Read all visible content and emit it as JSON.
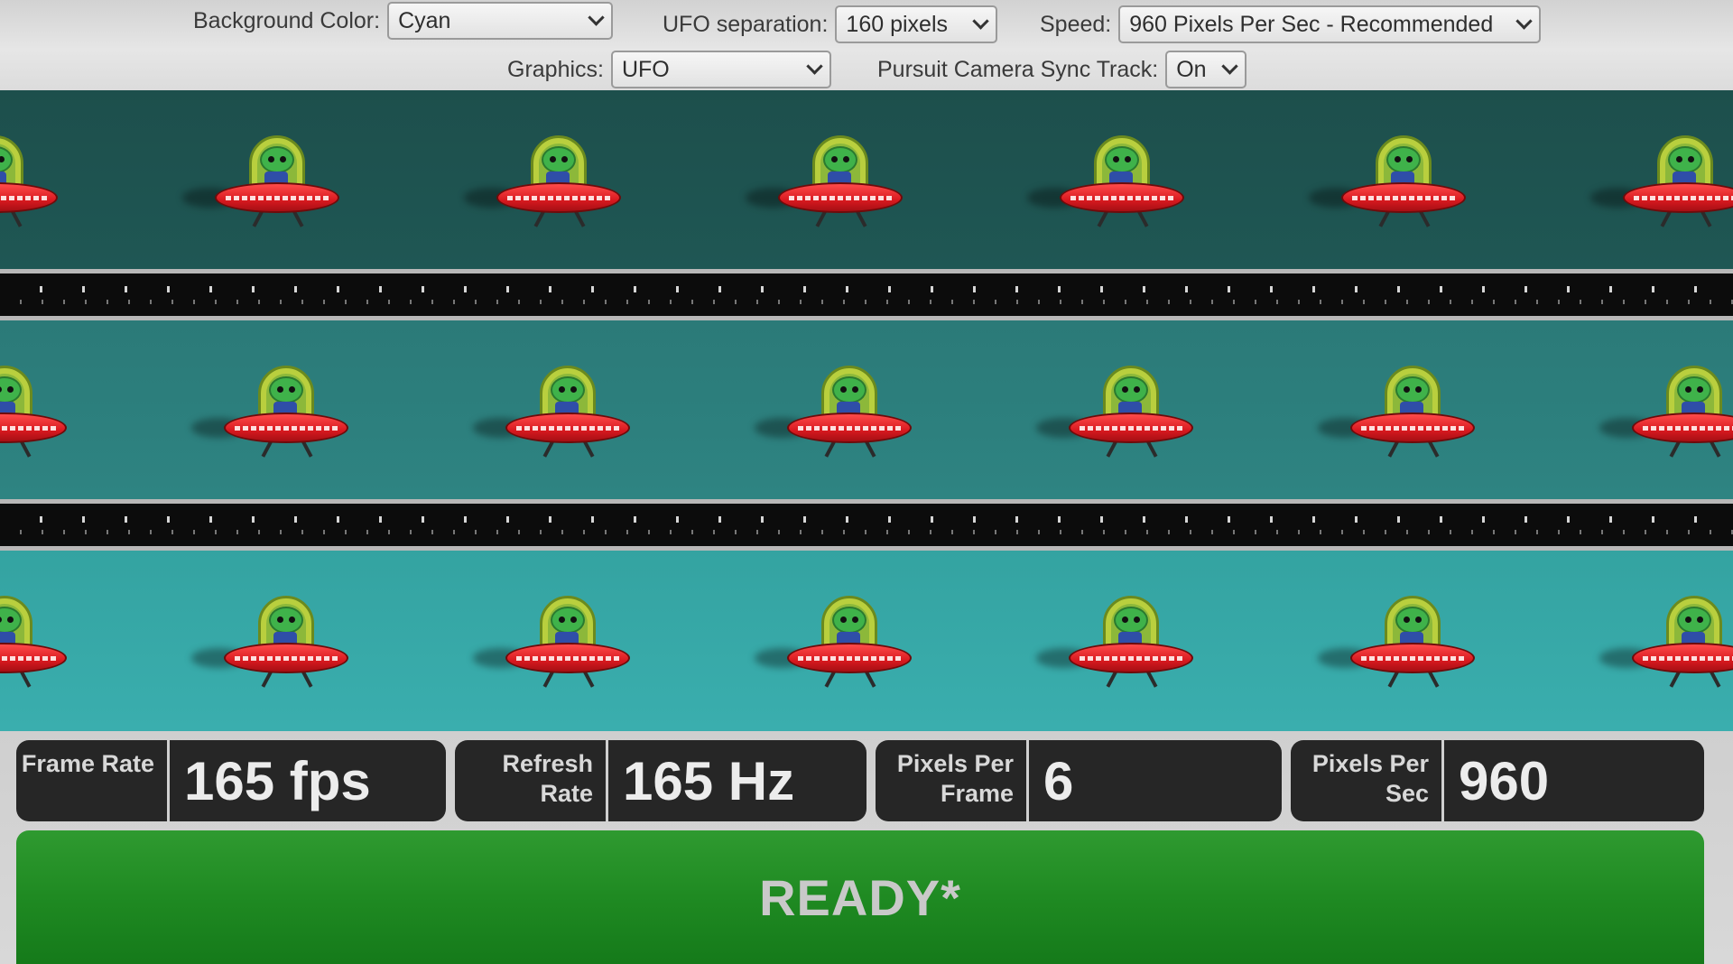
{
  "controls": {
    "background_color": {
      "label": "Background Color:",
      "value": "Cyan"
    },
    "ufo_separation": {
      "label": "UFO separation:",
      "value": "160 pixels"
    },
    "speed": {
      "label": "Speed:",
      "value": "960 Pixels Per Sec - Recommended"
    },
    "graphics": {
      "label": "Graphics:",
      "value": "UFO"
    },
    "pursuit_camera": {
      "label": "Pursuit Camera Sync Track:",
      "value": "On"
    }
  },
  "lanes": {
    "count": 3,
    "ufos_per_lane": 7,
    "sprite": "ufo-icon",
    "colors": {
      "lane_1": "#1f5754",
      "lane_2": "#2e8482",
      "lane_3": "#3aaeae"
    }
  },
  "stats": {
    "frame_rate": {
      "label": "Frame Rate",
      "value": "165 fps"
    },
    "refresh_rate": {
      "label": "Refresh Rate",
      "value": "165 Hz"
    },
    "pixels_per_frame": {
      "label": "Pixels Per Frame",
      "value": "6"
    },
    "pixels_per_sec": {
      "label": "Pixels Per Sec",
      "value": "960"
    }
  },
  "status": {
    "text": "READY*",
    "color": "#1f8a22"
  }
}
